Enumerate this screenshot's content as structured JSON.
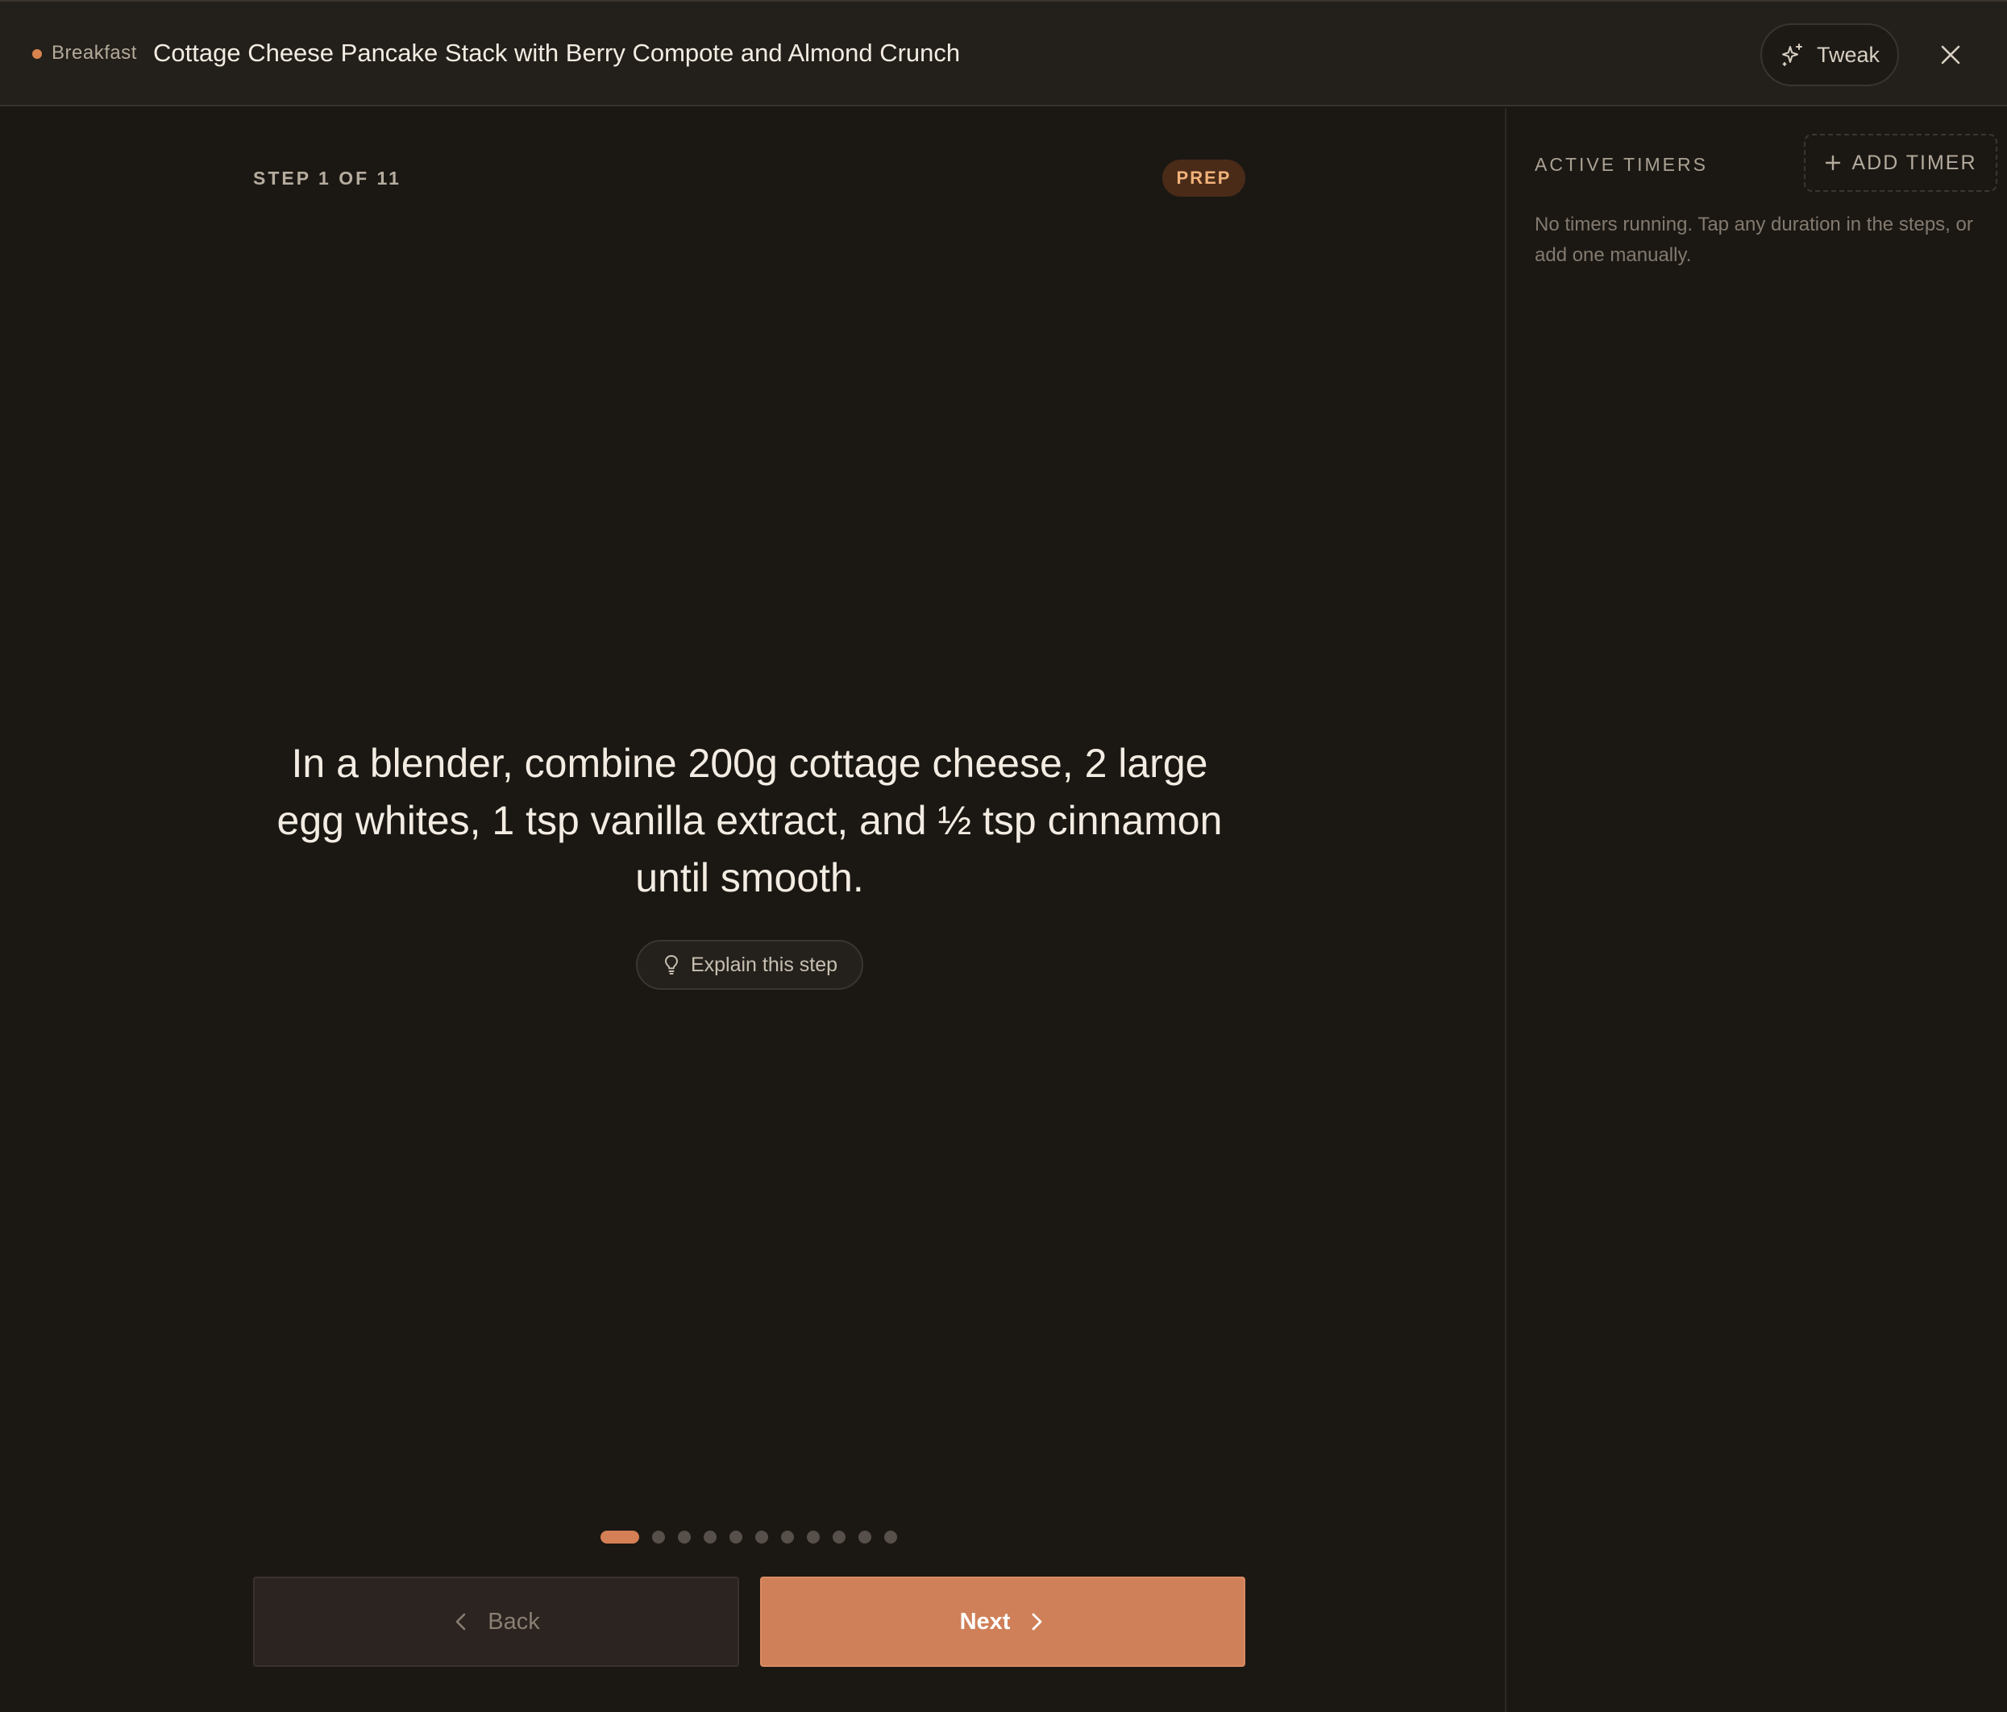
{
  "header": {
    "category": "Breakfast",
    "title": "Cottage Cheese Pancake Stack with Berry Compote and Almond Crunch",
    "tweak_label": "Tweak"
  },
  "step": {
    "label": "STEP 1 OF 11",
    "current": 1,
    "total": 11,
    "phase": "PREP",
    "instruction": "In a blender, combine 200g cottage cheese, 2 large egg whites, 1 tsp vanilla extract, and ½ tsp cinnamon until smooth.",
    "explain_label": "Explain this step"
  },
  "nav": {
    "back_label": "Back",
    "next_label": "Next"
  },
  "timers": {
    "title": "ACTIVE TIMERS",
    "add_label": "ADD TIMER",
    "empty_text": "No timers running. Tap any duration in the steps, or add one manually."
  },
  "icons": {
    "category": "dot-icon",
    "tweak": "sparkle-icon",
    "close": "close-icon",
    "explain": "lightbulb-icon",
    "back": "chevron-left-icon",
    "next": "chevron-right-icon",
    "add_timer": "plus-icon"
  },
  "colors": {
    "accent": "#cf8059",
    "badge_bg": "#4a2b18",
    "badge_text": "#f0b27a",
    "background": "#1b1814",
    "header_bg": "#23201b"
  }
}
